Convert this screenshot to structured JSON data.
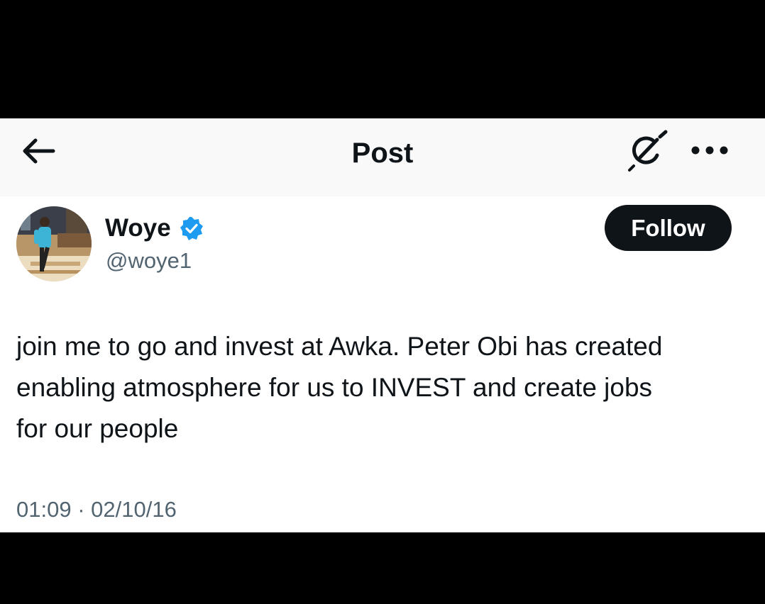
{
  "header": {
    "title": "Post",
    "back_icon": "arrow-left-icon",
    "grok_icon": "grok-icon",
    "more_icon": "more-horizontal-icon"
  },
  "post": {
    "author": {
      "name": "Woye",
      "handle": "@woye1",
      "verified": true,
      "verified_color": "#1d9bf0",
      "avatar_icon": "avatar"
    },
    "follow_label": "Follow",
    "text_lines": [
      "join me to go and invest at Awka. Peter Obi has created",
      "enabling atmosphere for us to INVEST and create jobs",
      "for our people"
    ],
    "time": "01:09",
    "separator": "·",
    "date": "02/10/16"
  },
  "colors": {
    "text_primary": "#0f1419",
    "text_secondary": "#536471",
    "follow_bg": "#0f1419",
    "follow_text": "#ffffff",
    "header_bg": "#f9f9f9",
    "background": "#ffffff"
  }
}
